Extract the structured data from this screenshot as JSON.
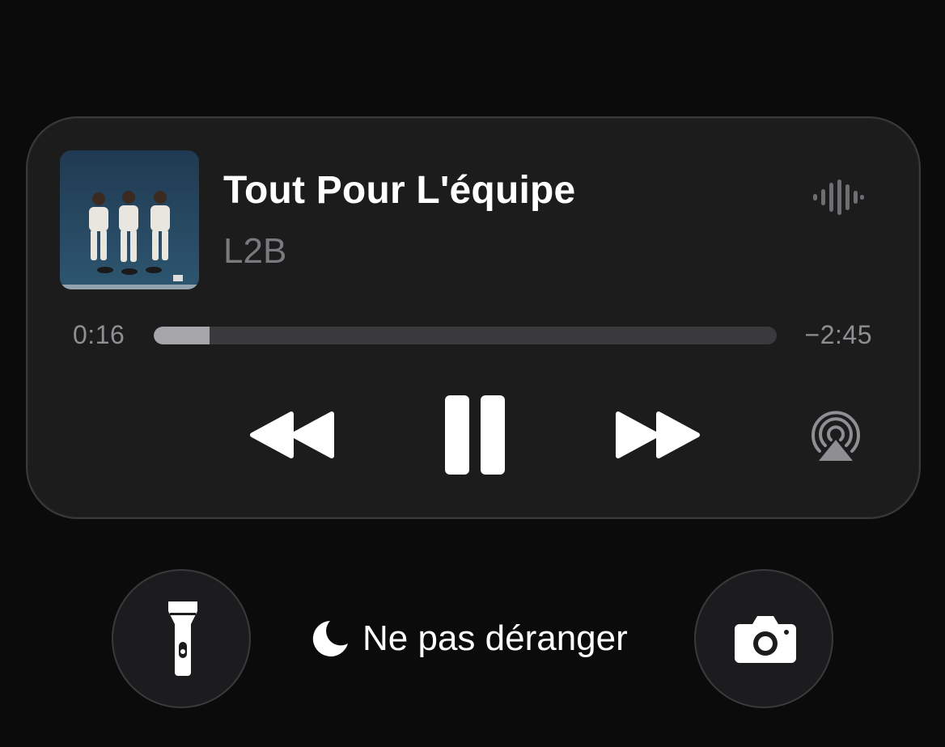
{
  "now_playing": {
    "title": "Tout Pour L'équipe",
    "artist": "L2B",
    "elapsed": "0:16",
    "remaining": "−2:45",
    "progress": 0.09
  },
  "icons": {
    "waveform": "waveform-icon",
    "rewind": "backward-icon",
    "pause": "pause-icon",
    "forward": "forward-icon",
    "airplay": "airplay-audio-icon",
    "flashlight": "flashlight-icon",
    "camera": "camera-icon",
    "moon": "moon-icon"
  },
  "quick_actions": {
    "focus_label": "Ne pas déranger"
  },
  "colors": {
    "background": "#0b0b0b",
    "card": "#1c1c1d",
    "secondary_text": "#8e8e93",
    "progress_fill": "#a5a5aa",
    "progress_track": "#3a3a3d"
  }
}
